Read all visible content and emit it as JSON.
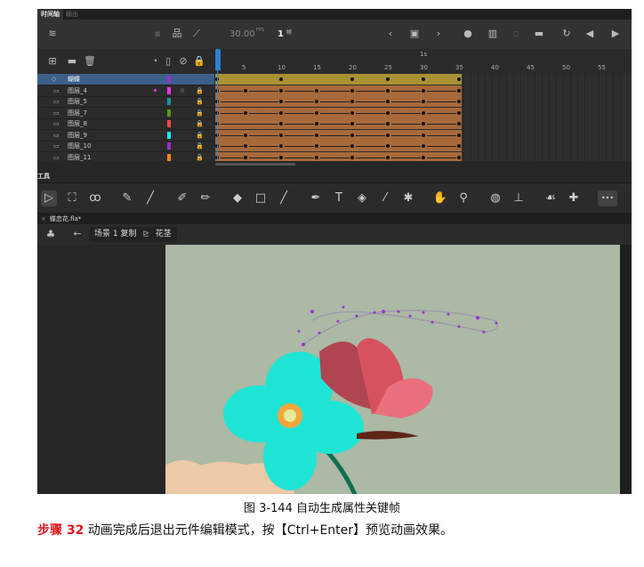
{
  "panel_tabs": [
    "时间轴",
    "输出"
  ],
  "timeline": {
    "fps": "30.00",
    "fps_unit": "FPS",
    "frame": "1",
    "frame_unit": "帧",
    "ruler_labels": [
      "5",
      "10",
      "15",
      "20",
      "25",
      "30",
      "35",
      "40",
      "45",
      "50",
      "55"
    ],
    "time_marker": "1s",
    "span_end_frame": 35,
    "layers": [
      {
        "name": "蝴蝶",
        "color": "#9b30d0",
        "type": "symbol",
        "selected": true,
        "span_color": "#a89232",
        "keyframes": [
          1,
          10,
          20,
          25,
          30,
          35
        ],
        "tween": false
      },
      {
        "name": "图层_4",
        "color": "#ff33ee",
        "type": "layer",
        "hidden": true,
        "span_color": "#a8693a",
        "keyframes": [
          1,
          5,
          10,
          15,
          20,
          25,
          30,
          35
        ],
        "tween": true
      },
      {
        "name": "图层_5",
        "color": "#139a9a",
        "type": "layer",
        "span_color": "#a8693a",
        "keyframes": [
          1,
          10,
          15,
          20,
          25,
          30,
          35
        ],
        "tween": true
      },
      {
        "name": "图层_7",
        "color": "#5a9a10",
        "type": "layer",
        "span_color": "#a8693a",
        "keyframes": [
          1,
          5,
          10,
          15,
          20,
          25,
          30,
          35
        ],
        "tween": true
      },
      {
        "name": "图层_8",
        "color": "#ff4444",
        "type": "layer",
        "span_color": "#a8693a",
        "keyframes": [
          1,
          10,
          15,
          20,
          25,
          30,
          35
        ],
        "tween": true
      },
      {
        "name": "图层_9",
        "color": "#00f0f0",
        "type": "layer",
        "span_color": "#a8693a",
        "keyframes": [
          1,
          5,
          10,
          15,
          20,
          25,
          30,
          35
        ],
        "tween": true
      },
      {
        "name": "图层_10",
        "color": "#9b30d0",
        "type": "layer",
        "span_color": "#a8693a",
        "keyframes": [
          1,
          5,
          10,
          15,
          20,
          25,
          30,
          35
        ],
        "tween": true
      },
      {
        "name": "图层_11",
        "color": "#ff8800",
        "type": "layer",
        "span_color": "#a8693a",
        "keyframes": [
          1,
          5,
          10,
          15,
          20,
          25,
          30,
          35
        ],
        "tween": true
      }
    ]
  },
  "tools_label": "工具",
  "tools": [
    {
      "name": "selection-tool",
      "g": "▷"
    },
    {
      "name": "free-transform-tool",
      "g": "⛶"
    },
    {
      "name": "lasso-tool",
      "g": "ꝏ"
    },
    {
      "name": "paint-brush-tool",
      "g": "✎"
    },
    {
      "name": "brush-tool",
      "g": "╱"
    },
    {
      "name": "fluid-brush-tool",
      "g": "✐"
    },
    {
      "name": "pencil-tool",
      "g": "✏"
    },
    {
      "name": "eraser-tool",
      "g": "◆"
    },
    {
      "name": "rectangle-tool",
      "g": "□"
    },
    {
      "name": "line-tool",
      "g": "╱"
    },
    {
      "name": "pen-tool",
      "g": "✒"
    },
    {
      "name": "text-tool",
      "g": "T"
    },
    {
      "name": "paint-bucket-tool",
      "g": "◈"
    },
    {
      "name": "eyedropper-tool",
      "g": "⁄"
    },
    {
      "name": "pin-tool",
      "g": "✱"
    },
    {
      "name": "hand-tool",
      "g": "✋"
    },
    {
      "name": "zoom-tool",
      "g": "⚲"
    },
    {
      "name": "3d-rotation-tool",
      "g": "◍"
    },
    {
      "name": "bone-axis-tool",
      "g": "⊥"
    },
    {
      "name": "asset-warp-tool",
      "g": "☙"
    },
    {
      "name": "bone-tool",
      "g": "✚"
    },
    {
      "name": "more-tools",
      "g": "•••"
    }
  ],
  "file_tab": "蝶恋花.fla*",
  "breadcrumb": {
    "scene": "场景 1 复制",
    "symbol": "花茎"
  },
  "caption": "图  3-144  自动生成属性关键帧",
  "step": {
    "label": "步骤 32",
    "text": " 动画完成后退出元件编辑模式，按【Ctrl+Enter】预览动画效果。"
  }
}
